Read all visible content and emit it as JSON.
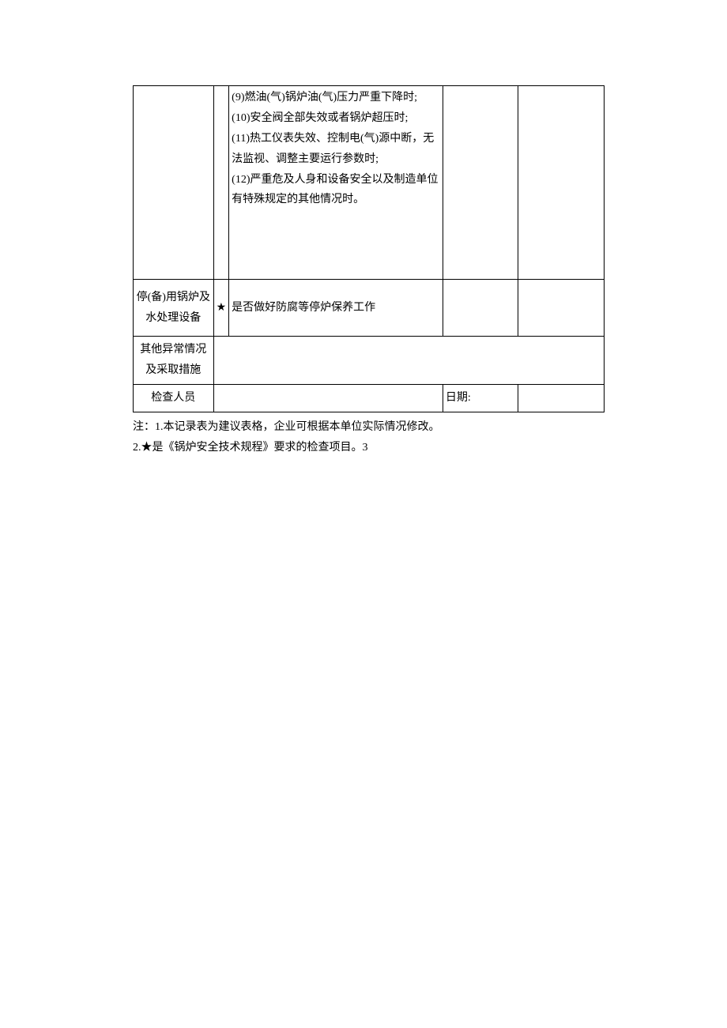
{
  "table": {
    "row1": {
      "col1": "",
      "col2": "",
      "col3_lines": [
        "(9)燃油(气)锅炉油(气)压力严重下降时;",
        "(10)安全阀全部失效或者锅炉超压时;",
        "(11)热工仪表失效、控制电(气)源中断，无法监视、调整主要运行参数时;",
        "(12)严重危及人身和设备安全以及制造单位有特殊规定的其他情况时。"
      ],
      "col4": "",
      "col5": ""
    },
    "row2": {
      "col1": "停(备)用锅炉及水处理设备",
      "col2": "★",
      "col3": "是否做好防腐等停炉保养工作",
      "col4": "",
      "col5": ""
    },
    "row3": {
      "col1": "其他异常情况及采取措施",
      "rest": ""
    },
    "row4": {
      "col1": "检查人员",
      "col2_blank": "",
      "col3_label": "日期:",
      "col4_blank": ""
    }
  },
  "notes": {
    "line1": "注：1.本记录表为建议表格，企业可根据本单位实际情况修改。",
    "line2": "2.★是《锅炉安全技术规程》要求的检查项目。3"
  }
}
